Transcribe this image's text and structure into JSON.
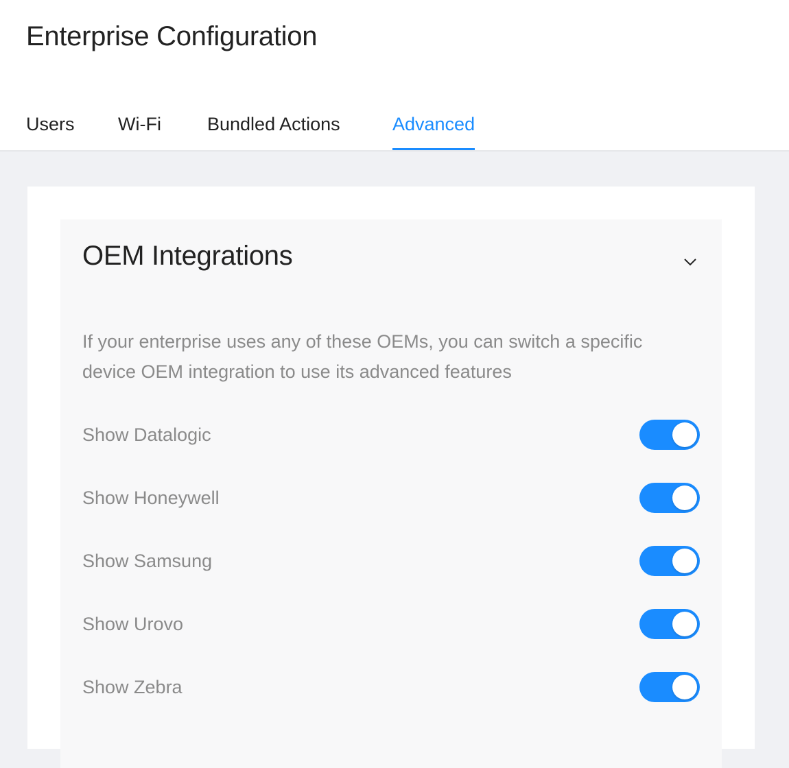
{
  "header": {
    "title": "Enterprise Configuration"
  },
  "tabs": [
    {
      "label": "Users",
      "active": false
    },
    {
      "label": "Wi-Fi",
      "active": false
    },
    {
      "label": "Bundled Actions",
      "active": false
    },
    {
      "label": "Advanced",
      "active": true
    }
  ],
  "section": {
    "title": "OEM Integrations",
    "expander_icon": "chevron-down-icon",
    "description": "If your enterprise uses any of these OEMs, you can switch a specific device OEM integration to use its advanced features",
    "items": [
      {
        "label": "Show Datalogic",
        "enabled": true
      },
      {
        "label": "Show Honeywell",
        "enabled": true
      },
      {
        "label": "Show Samsung",
        "enabled": true
      },
      {
        "label": "Show Urovo",
        "enabled": true
      },
      {
        "label": "Show Zebra",
        "enabled": true
      }
    ]
  },
  "colors": {
    "accent": "#1a8cff",
    "page_background": "#f0f1f4",
    "panel_background": "#f8f8f9",
    "title_text": "#222222",
    "muted_text": "#8a8a8a"
  }
}
